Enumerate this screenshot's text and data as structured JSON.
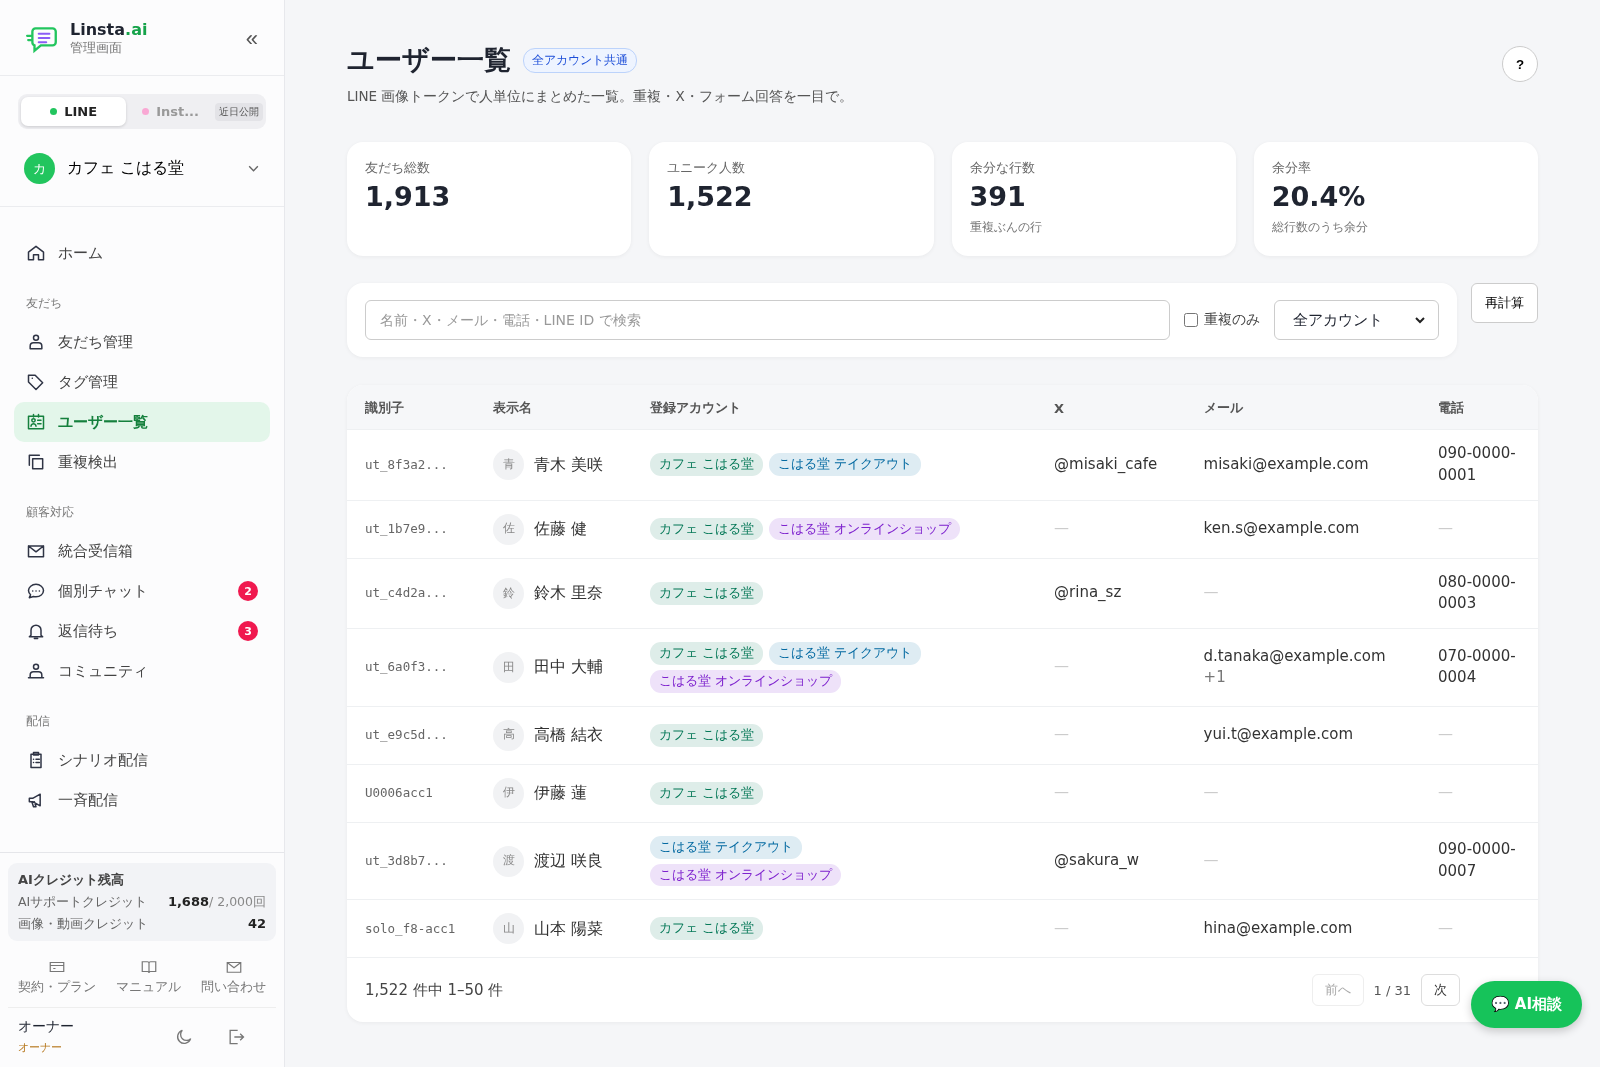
{
  "brand": {
    "name": "Linsta",
    "name_suffix": ".ai",
    "subtitle": "管理画面",
    "collapse": "«"
  },
  "channel_tabs": [
    {
      "label": "LINE",
      "selected": true,
      "disabled": false,
      "color": "#22c55e"
    },
    {
      "label": "Inst...",
      "selected": false,
      "disabled": true,
      "color": "#f9a8d4",
      "badge": "近日公開"
    }
  ],
  "account": {
    "initial": "カ",
    "name": "カフェ こはる堂"
  },
  "nav": [
    {
      "items": [
        {
          "label": "ホーム",
          "selected": false
        }
      ]
    },
    {
      "heading": "友だち",
      "items": [
        {
          "label": "友だち管理",
          "selected": false
        },
        {
          "label": "タグ管理",
          "selected": false
        },
        {
          "label": "ユーザー一覧",
          "selected": true
        },
        {
          "label": "重複検出",
          "selected": false
        }
      ]
    },
    {
      "heading": "顧客対応",
      "items": [
        {
          "label": "統合受信箱",
          "selected": false
        },
        {
          "label": "個別チャット",
          "selected": false,
          "badge": "2"
        },
        {
          "label": "返信待ち",
          "selected": false,
          "badge": "3"
        },
        {
          "label": "コミュニティ",
          "selected": false
        }
      ]
    },
    {
      "heading": "配信",
      "items": [
        {
          "label": "シナリオ配信",
          "selected": false
        },
        {
          "label": "一斉配信",
          "selected": false
        }
      ]
    }
  ],
  "credits": {
    "title": "AIクレジット残高",
    "rows": [
      {
        "label": "AIサポートクレジット",
        "value": "1,688",
        "limit": "/ 2,000回"
      },
      {
        "label": "画像・動画クレジット",
        "value": "42"
      }
    ]
  },
  "footer_links": [
    "契約・プラン",
    "マニュアル",
    "問い合わせ"
  ],
  "user": {
    "name": "オーナー",
    "role": "オーナー"
  },
  "page": {
    "title": "ユーザー一覧",
    "badge": "全アカウント共通",
    "description": "LINE 画像トークンで人単位にまとめた一覧。重複・X・フォーム回答を一目で。",
    "help": "?"
  },
  "stats": [
    {
      "label": "友だち総数",
      "value": "1,913"
    },
    {
      "label": "ユニーク人数",
      "value": "1,522"
    },
    {
      "label": "余分な行数",
      "value": "391",
      "note": "重複ぶんの行"
    },
    {
      "label": "余分率",
      "value": "20.4%",
      "note": "総行数のうち余分"
    }
  ],
  "filters": {
    "search": {
      "placeholder": "名前・X・メール・電話・LINE ID で検索"
    },
    "duplicates_only": {
      "label": "重複のみ",
      "checked": false
    },
    "account_select": "全アカウント",
    "recalc": "再計算"
  },
  "table": {
    "columns": [
      "識別子",
      "表示名",
      "登録アカウント",
      "X",
      "メール",
      "電話"
    ],
    "rows": [
      {
        "id": "ut_8f3a2...",
        "initial": "青",
        "name": "青木 美咲",
        "accounts": [
          {
            "label": "カフェ こはる堂",
            "color": "#047857"
          },
          {
            "label": "こはる堂 テイクアウト",
            "color": "#0369a1"
          }
        ],
        "x": "@misaki_cafe",
        "email": "misaki@example.com",
        "phone": "090-0000-0001"
      },
      {
        "id": "ut_1b7e9...",
        "initial": "佐",
        "name": "佐藤 健",
        "accounts": [
          {
            "label": "カフェ こはる堂",
            "color": "#047857"
          },
          {
            "label": "こはる堂 オンラインショップ",
            "color": "#7e22ce"
          }
        ],
        "x": "—",
        "email": "ken.s@example.com",
        "phone": "—"
      },
      {
        "id": "ut_c4d2a...",
        "initial": "鈴",
        "name": "鈴木 里奈",
        "accounts": [
          {
            "label": "カフェ こはる堂",
            "color": "#047857"
          }
        ],
        "x": "@rina_sz",
        "email": "—",
        "phone": "080-0000-0003"
      },
      {
        "id": "ut_6a0f3...",
        "initial": "田",
        "name": "田中 大輔",
        "accounts": [
          {
            "label": "カフェ こはる堂",
            "color": "#047857"
          },
          {
            "label": "こはる堂 テイクアウト",
            "color": "#0369a1"
          },
          {
            "label": "こはる堂 オンラインショップ",
            "color": "#7e22ce"
          }
        ],
        "x": "—",
        "email": "d.tanaka@example.com",
        "email_extra": "+1",
        "phone": "070-0000-0004"
      },
      {
        "id": "ut_e9c5d...",
        "initial": "高",
        "name": "高橋 結衣",
        "accounts": [
          {
            "label": "カフェ こはる堂",
            "color": "#047857"
          }
        ],
        "x": "—",
        "email": "yui.t@example.com",
        "phone": "—"
      },
      {
        "id": "U0006acc1",
        "initial": "伊",
        "name": "伊藤 蓮",
        "accounts": [
          {
            "label": "カフェ こはる堂",
            "color": "#047857"
          }
        ],
        "x": "—",
        "email": "—",
        "phone": "—"
      },
      {
        "id": "ut_3d8b7...",
        "initial": "渡",
        "name": "渡辺 咲良",
        "accounts": [
          {
            "label": "こはる堂 テイクアウト",
            "color": "#0369a1"
          },
          {
            "label": "こはる堂 オンラインショップ",
            "color": "#7e22ce"
          }
        ],
        "x": "@sakura_w",
        "email": "—",
        "phone": "090-0000-0007"
      },
      {
        "id": "solo_f8-acc1",
        "initial": "山",
        "name": "山本 陽菜",
        "accounts": [
          {
            "label": "カフェ こはる堂",
            "color": "#047857"
          }
        ],
        "x": "—",
        "email": "hina@example.com",
        "phone": "—"
      }
    ]
  },
  "pagination": {
    "summary": "1,522 件中 1–50 件",
    "prev": {
      "label": "前へ",
      "disabled": true
    },
    "page": "1 / 31",
    "next": {
      "label": "次",
      "disabled": false
    }
  },
  "ai_button": {
    "icon": "💬",
    "label": "AI相談"
  }
}
